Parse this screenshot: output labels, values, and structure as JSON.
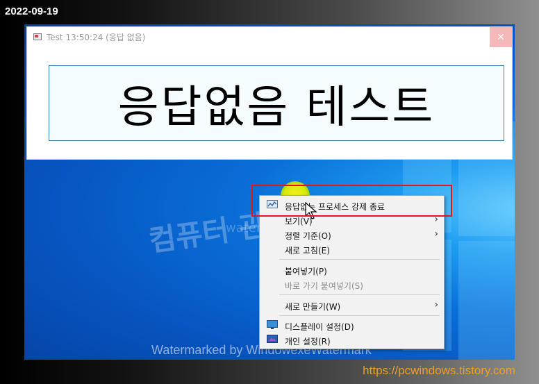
{
  "date_label": "2022-09-19",
  "source_url": "https://pcwindows.tistory.com",
  "window": {
    "title": "Test 13:50:24 (응답 없음)",
    "close_glyph": "✕",
    "panel_text": "응답없음 테스트"
  },
  "watermarks": {
    "big": "컴퓨터 관련 정보",
    "small": "watermarked windowexe",
    "bottom": "Watermarked by WindowexeWatermark"
  },
  "context_menu": {
    "items": [
      {
        "label": "응답없는 프로세스 강제 종료",
        "icon": "kill-process-icon"
      },
      {
        "label": "보기(V)",
        "submenu": true
      },
      {
        "label": "정렬 기준(O)",
        "submenu": true
      },
      {
        "label": "새로 고침(E)"
      },
      {
        "label": "붙여넣기(P)"
      },
      {
        "label": "바로 가기 붙여넣기(S)",
        "disabled": true
      },
      {
        "label": "새로 만들기(W)",
        "submenu": true
      },
      {
        "label": "디스플레이 설정(D)",
        "icon": "display-settings-icon"
      },
      {
        "label": "개인 설정(R)",
        "icon": "personalize-icon"
      }
    ],
    "submenu_glyph": "›"
  },
  "colors": {
    "highlight_border": "#e2141c",
    "url_color": "#f0a020"
  }
}
